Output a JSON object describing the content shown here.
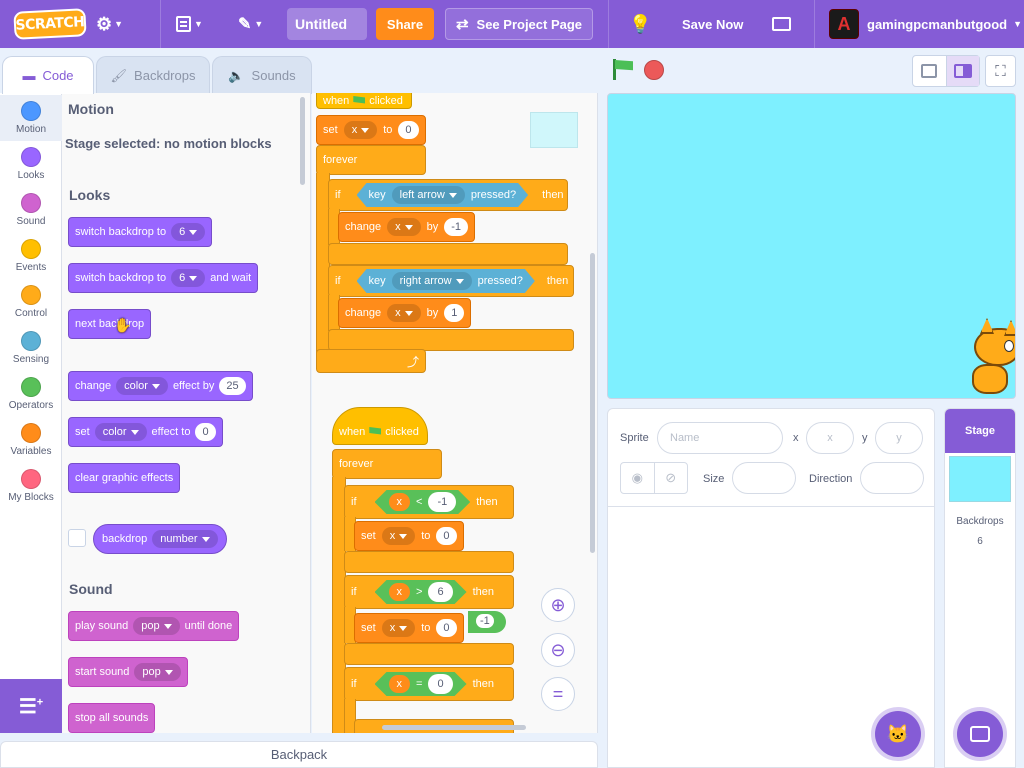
{
  "menubar": {
    "logo": "SCRATCH",
    "title": "Untitled",
    "share": "Share",
    "see_project": "See Project Page",
    "save_now": "Save Now",
    "username": "gamingpcmanbutgood"
  },
  "tabs": {
    "code": "Code",
    "backdrops": "Backdrops",
    "sounds": "Sounds"
  },
  "categories": [
    {
      "label": "Motion",
      "color": "#4c97ff"
    },
    {
      "label": "Looks",
      "color": "#9966ff"
    },
    {
      "label": "Sound",
      "color": "#cf63cf"
    },
    {
      "label": "Events",
      "color": "#ffbf00"
    },
    {
      "label": "Control",
      "color": "#ffab19"
    },
    {
      "label": "Sensing",
      "color": "#5cb1d6"
    },
    {
      "label": "Operators",
      "color": "#59c059"
    },
    {
      "label": "Variables",
      "color": "#ff8c1a"
    },
    {
      "label": "My Blocks",
      "color": "#ff6680"
    }
  ],
  "palette": {
    "motion_heading": "Motion",
    "motion_note": "Stage selected: no motion blocks",
    "looks_heading": "Looks",
    "switch_backdrop": "switch backdrop to",
    "switch_backdrop_value": "6",
    "and_wait": "and wait",
    "next_backdrop": "next backdrop",
    "change": "change",
    "effect_color": "color",
    "effect_by": "effect by",
    "effect_by_value": "25",
    "set": "set",
    "effect_to": "effect to",
    "effect_to_value": "0",
    "clear_effects": "clear graphic effects",
    "backdrop": "backdrop",
    "backdrop_prop": "number",
    "sound_heading": "Sound",
    "play_sound": "play sound",
    "sound_name": "pop",
    "until_done": "until done",
    "start_sound": "start sound",
    "stop_all": "stop all sounds"
  },
  "script1": {
    "when": "when",
    "clicked": "clicked",
    "set": "set",
    "var": "x",
    "to": "to",
    "set_value": "0",
    "forever": "forever",
    "if": "if",
    "then": "then",
    "key": "key",
    "pressed": "pressed?",
    "key1": "left arrow",
    "key2": "right arrow",
    "change": "change",
    "by": "by",
    "change1": "-1",
    "change2": "1"
  },
  "script2": {
    "when": "when",
    "clicked": "clicked",
    "forever": "forever",
    "if": "if",
    "then": "then",
    "var": "x",
    "lt": "<",
    "gt": ">",
    "eq": "=",
    "cmp1": "-1",
    "cmp2": "6",
    "cmp3": "0",
    "set": "set",
    "to": "to",
    "set1": "0",
    "set2": "0",
    "hidden_value": "-1"
  },
  "sprite_info": {
    "sprite_label": "Sprite",
    "name_placeholder": "Name",
    "x_label": "x",
    "x_placeholder": "x",
    "y_label": "y",
    "y_placeholder": "y",
    "size_label": "Size",
    "direction_label": "Direction"
  },
  "stage_panel": {
    "title": "Stage",
    "backdrops_label": "Backdrops",
    "backdrops_count": "6"
  },
  "backpack": "Backpack",
  "zoom": {
    "reset_symbol": "="
  }
}
